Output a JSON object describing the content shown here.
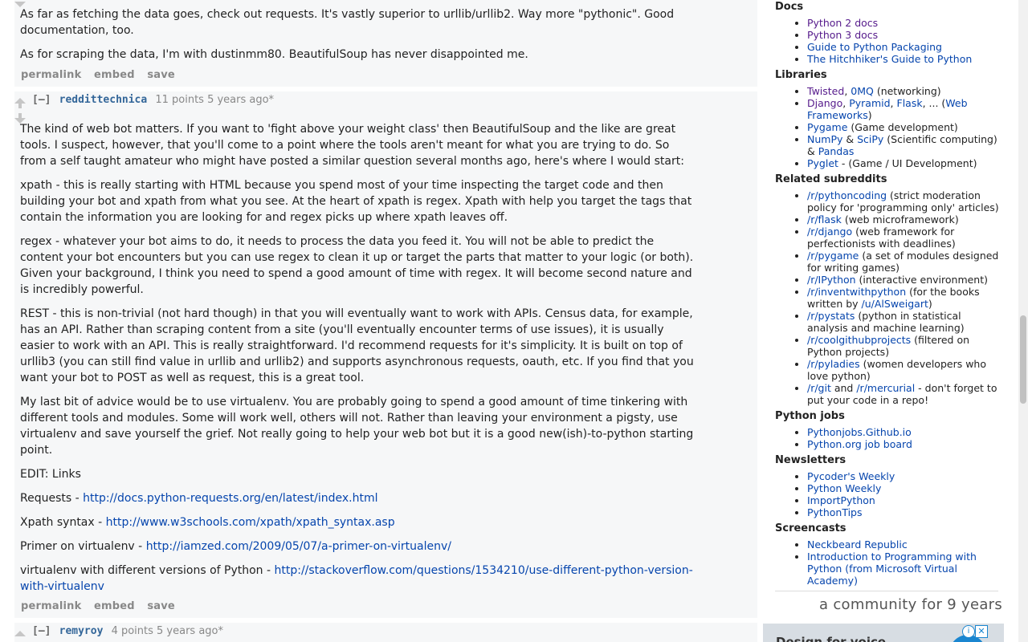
{
  "comment1": {
    "paragraphs": [
      "As far as fetching the data goes, check out requests. It's vastly superior to urllib/urllib2. Way more \"pythonic\". Good documentation, too.",
      "As for scraping the data, I'm with dustinmm80. BeautifulSoup has never disappointed me."
    ],
    "buttons": [
      "permalink",
      "embed",
      "save"
    ]
  },
  "comment2": {
    "expand": "[–]",
    "author": "reddittechnica",
    "meta": "11 points 5 years ago*",
    "paragraphs": [
      "The kind of web bot matters. If you want to 'fight above your weight class' then BeautifulSoup and the like are great tools. I suspect, however, that you'll come to a point where the tools aren't meant for what you are trying to do. So from a self taught amateur who might have posted a similar question several months ago, here's where I would start:",
      "xpath - this is really starting with HTML because you spend most of your time inspecting the target code and then building your bot and xpath from what you see. At the heart of xpath is regex. Xpath with help you target the tags that contain the information you are looking for and regex picks up where xpath leaves off.",
      "regex - whatever your bot aims to do, it needs to process the data you feed it. You will not be able to predict the content your bot encounters but you can use regex to clean it up or target the parts that matter to your logic (or both). Given your background, I think you need to spend a good amount of time with regex. It will become second nature and is incredibly powerful.",
      "REST - this is non-trivial (not hard though) in that you will eventually want to work with APIs. Census data, for example, has an API. Rather than scraping content from a site (you'll eventually encounter terms of use issues), it is usually easier to work with an API. This is really straightforward. I'd recommend requests for it's simplicity. It is built on top of urllib3 (you can still find value in urllib and urllib2) and supports asynchronous requests, oauth, etc. If you find that you want your bot to POST as well as request, this is a great tool.",
      "My last bit of advice would be to use virtualenv. You are probably going to spend a good amount of time tinkering with different tools and modules. Some will work well, others will not. Rather than leaving your environment a pigsty, use virtualenv and save yourself the grief. Not really going to help your web bot but it is a good new(ish)-to-python starting point.",
      "EDIT: Links"
    ],
    "links": [
      {
        "label": "Requests - ",
        "url": "http://docs.python-requests.org/en/latest/index.html"
      },
      {
        "label": "Xpath syntax - ",
        "url": "http://www.w3schools.com/xpath/xpath_syntax.asp"
      },
      {
        "label": "Primer on virtualenv - ",
        "url": "http://iamzed.com/2009/05/07/a-primer-on-virtualenv/"
      },
      {
        "label": "virtualenv with different versions of Python - ",
        "url": "http://stackoverflow.com/questions/1534210/use-different-python-version-with-virtualenv"
      }
    ],
    "buttons": [
      "permalink",
      "embed",
      "save"
    ]
  },
  "comment3": {
    "expand": "[–]",
    "author": "remyroy",
    "meta": "4 points 5 years ago*"
  },
  "sidebar": {
    "docs_title": "Docs",
    "docs": [
      "Python 2 docs",
      "Python 3 docs",
      "Guide to Python Packaging",
      "The Hitchhiker's Guide to Python"
    ],
    "libraries_title": "Libraries",
    "libraries": {
      "twisted": "Twisted",
      "zeromq": "0MQ",
      "networking": " (networking)",
      "django": "Django",
      "pyramid": "Pyramid",
      "flask": "Flask",
      "more": ", ... (",
      "web_frameworks": "Web Frameworks",
      "close": ")",
      "pygame": "Pygame",
      "pygame_desc": " (Game development)",
      "numpy": "NumPy",
      "scipy": "SciPy",
      "sci_desc": " (Scientific computing)",
      "pandas": "Pandas",
      "pyglet": "Pyglet",
      "pyglet_desc": " - (Game / UI Development)"
    },
    "related_title": "Related subreddits",
    "related": [
      {
        "link": "/r/pythoncoding",
        "desc": " (strict moderation policy for 'programming only' articles)"
      },
      {
        "link": "/r/flask",
        "desc": " (web microframework)"
      },
      {
        "link": "/r/django",
        "desc": " (web framework for perfectionists with deadlines)"
      },
      {
        "link": "/r/pygame",
        "desc": " (a set of modules designed for writing games)"
      },
      {
        "link": "/r/IPython",
        "desc": " (interactive environment)"
      },
      {
        "link": "/r/inventwithpython",
        "desc": " (for the books written by "
      },
      {
        "link": "/r/pystats",
        "desc": " (python in statistical analysis and machine learning)"
      },
      {
        "link": "/r/coolgithubprojects",
        "desc": " (filtered on Python projects)"
      },
      {
        "link": "/r/pyladies",
        "desc": " (women developers who love python)"
      },
      {
        "link": "/r/git",
        "desc": " - don't forget to put your code in a repo!"
      }
    ],
    "inventwithpython_user": "/u/AlSweigart",
    "inventwithpython_close": ")",
    "git_and": " and ",
    "mercurial": "/r/mercurial",
    "jobs_title": "Python jobs",
    "jobs": [
      "Pythonjobs.Github.io",
      "Python.org job board"
    ],
    "newsletters_title": "Newsletters",
    "newsletters": [
      "Pycoder's Weekly",
      "Python Weekly",
      "ImportPython",
      "PythonTips"
    ],
    "screencasts_title": "Screencasts",
    "screencasts": [
      "Neckbeard Republic",
      "Introduction to Programming with Python (from Microsoft Virtual Academy)"
    ],
    "community": "a community for 9 years",
    "ad_text": "Design for voice",
    "ad_info": "i",
    "ad_close": "✕"
  }
}
